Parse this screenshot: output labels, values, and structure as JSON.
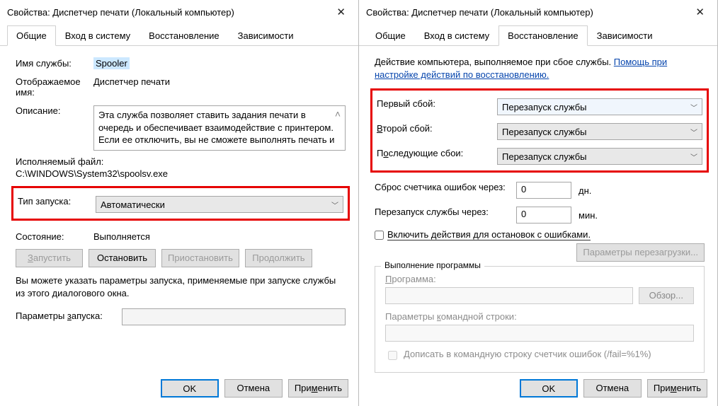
{
  "windowTitle": "Свойства: Диспетчер печати (Локальный компьютер)",
  "tabs": {
    "general": "Общие",
    "logon": "Вход в систему",
    "recovery": "Восстановление",
    "dependencies": "Зависимости"
  },
  "general": {
    "labels": {
      "name": "Имя службы:",
      "display": "Отображаемое имя:",
      "desc": "Описание:",
      "exec": "Исполняемый файл:",
      "startup": "Тип запуска:",
      "state": "Состояние:",
      "params": "Параметры запуска:"
    },
    "serviceName": "Spooler",
    "displayName": "Диспетчер печати",
    "description": "Эта служба позволяет ставить задания печати в очередь и обеспечивает взаимодействие с принтером. Если ее отключить, вы не сможете выполнять печать и видеть свои принтеры.",
    "execPath": "C:\\WINDOWS\\System32\\spoolsv.exe",
    "startupType": "Автоматически",
    "stateValue": "Выполняется",
    "btnStart": "Запустить",
    "btnStop": "Остановить",
    "btnPause": "Приостановить",
    "btnResume": "Продолжить",
    "hint": "Вы можете указать параметры запуска, применяемые при запуске службы из этого диалогового окна."
  },
  "recovery": {
    "topText": "Действие компьютера, выполняемое при сбое службы. ",
    "helpLink": "Помощь при настройке действий по восстановлению.",
    "first": "Первый сбой:",
    "second": "Второй сбой:",
    "subsequent": "Последующие сбои:",
    "action": "Перезапуск службы",
    "resetFail": "Сброс счетчика ошибок через:",
    "resetUnit": "дн.",
    "restartAfter": "Перезапуск службы через:",
    "restartUnit": "мин.",
    "zero": "0",
    "enableActions": "Включить действия для остановок с ошибками.",
    "restartParams": "Параметры перезагрузки...",
    "fieldsetTitle": "Выполнение программы",
    "program": "Программа:",
    "browse": "Обзор...",
    "cmdline": "Параметры командной строки:",
    "appendFail": "Дописать в командную строку счетчик ошибок (/fail=%1%)"
  },
  "buttons": {
    "ok": "OK",
    "cancel": "Отмена",
    "apply": "Применить"
  }
}
